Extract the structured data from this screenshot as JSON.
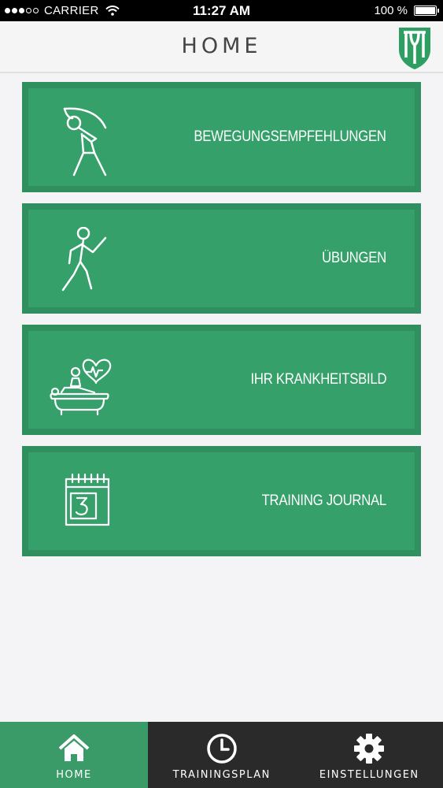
{
  "status_bar": {
    "carrier": "CARRIER",
    "time": "11:27 AM",
    "battery": "100 %"
  },
  "header": {
    "title": "HOME",
    "logo_icon": "university-shield-logo"
  },
  "menu": {
    "items": [
      {
        "label": "BEWEGUNGSEMPFEHLUNGEN",
        "icon": "stretching-person-icon"
      },
      {
        "label": "ÜBUNGEN",
        "icon": "exercising-person-icon"
      },
      {
        "label": "IHR KRANKHEITSBILD",
        "icon": "patient-heart-icon"
      },
      {
        "label": "TRAINING JOURNAL",
        "icon": "calendar-icon"
      }
    ]
  },
  "tab_bar": {
    "tabs": [
      {
        "label": "HOME",
        "icon": "home-icon",
        "active": true
      },
      {
        "label": "TRAININGSPLAN",
        "icon": "clock-icon",
        "active": false
      },
      {
        "label": "EINSTELLUNGEN",
        "icon": "gear-icon",
        "active": false
      }
    ]
  },
  "colors": {
    "card_border": "#2f8f5f",
    "card_fill": "#35a06a",
    "tab_active": "#3a9a68",
    "tab_bar": "#2a2a2a"
  }
}
